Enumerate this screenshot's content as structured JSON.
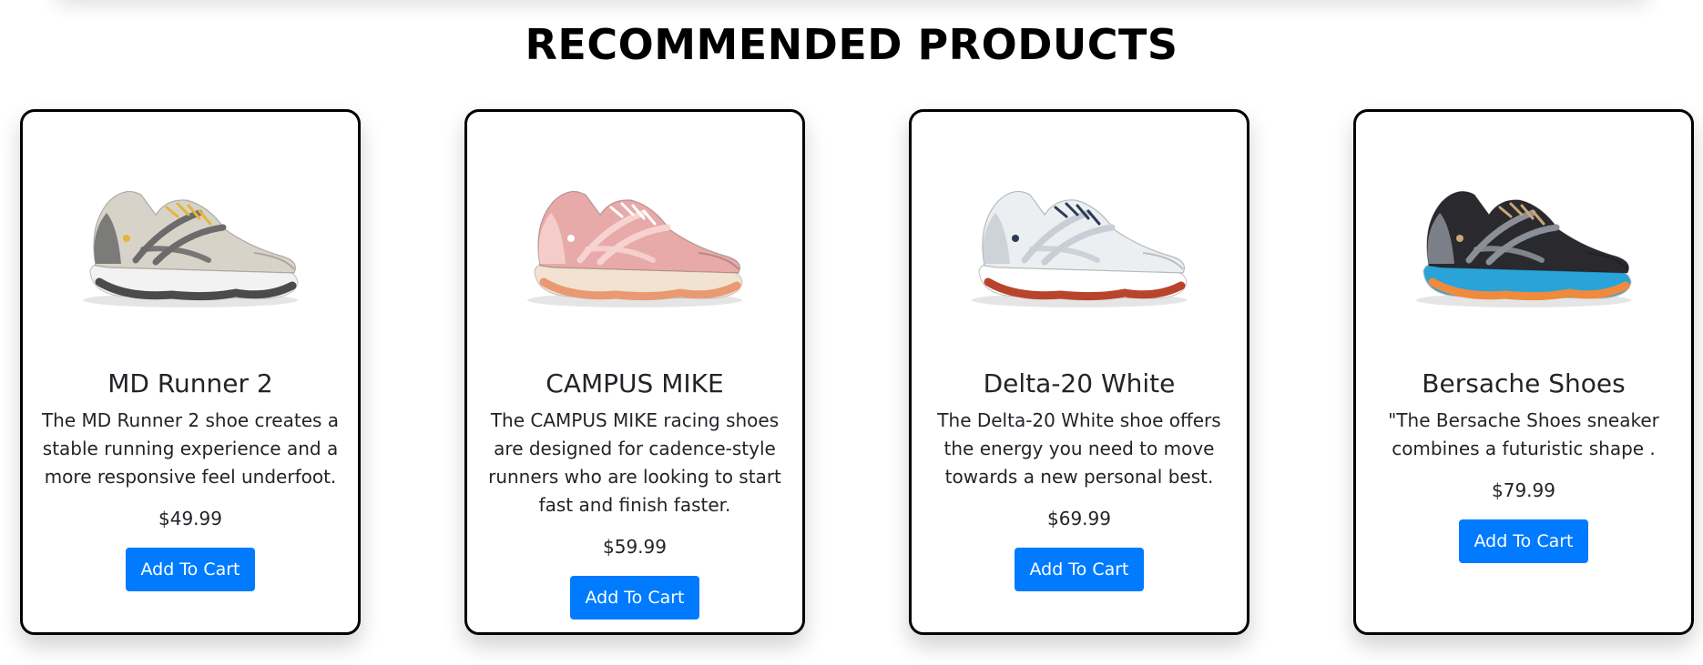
{
  "section": {
    "title": "RECOMMENDED PRODUCTS"
  },
  "products": [
    {
      "name": "MD Runner 2",
      "description": "The MD Runner 2 shoe creates a stable running experience and a more responsive feel underfoot.",
      "price": "$49.99",
      "button_label": "Add To Cart",
      "image_icon": "shoe-beige-gray-icon",
      "colors": {
        "upper": "#d8d3c8",
        "accent": "#6b6b6b",
        "sole": "#f2f2f2",
        "sole_accent": "#4b4b4b",
        "detail": "#e5b43a"
      }
    },
    {
      "name": "CAMPUS MIKE",
      "description": "The CAMPUS MIKE racing shoes are designed for cadence-style runners who are looking to start fast and finish faster.",
      "price": "$59.99",
      "button_label": "Add To Cart",
      "image_icon": "shoe-pink-icon",
      "colors": {
        "upper": "#e8a9a9",
        "accent": "#f6d3d0",
        "sole": "#f1e3cf",
        "sole_accent": "#e99a73",
        "detail": "#ffffff"
      }
    },
    {
      "name": "Delta-20 White",
      "description": "The Delta-20 White shoe offers the energy you need to move towards a new personal best.",
      "price": "$69.99",
      "button_label": "Add To Cart",
      "image_icon": "shoe-white-red-icon",
      "colors": {
        "upper": "#eceff2",
        "accent": "#c9ced6",
        "sole": "#ffffff",
        "sole_accent": "#b9442c",
        "detail": "#2b3a55"
      }
    },
    {
      "name": "Bersache Shoes",
      "description": "\"The Bersache Shoes sneaker combines a futuristic shape .",
      "price": "$79.99",
      "button_label": "Add To Cart",
      "image_icon": "shoe-black-blue-icon",
      "colors": {
        "upper": "#2a2a2e",
        "accent": "#8a8f98",
        "sole": "#2aa3d8",
        "sole_accent": "#f08a3c",
        "detail": "#c9a77a"
      }
    }
  ],
  "colors": {
    "button_bg": "#007bff",
    "button_text": "#ffffff",
    "card_border": "#000000"
  }
}
